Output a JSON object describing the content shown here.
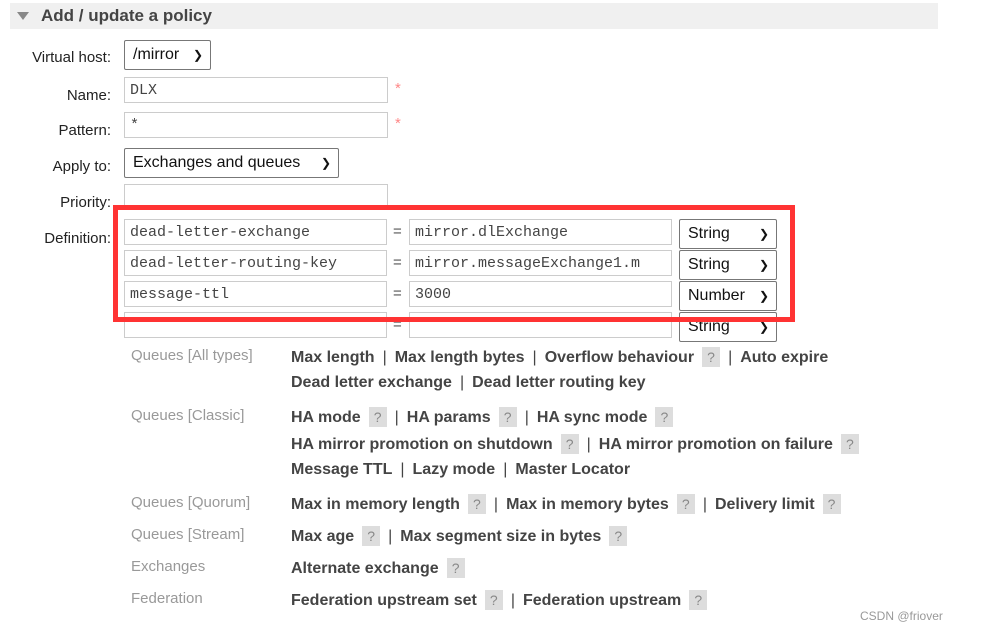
{
  "section_title": "Add / update a policy",
  "form": {
    "vhost_label": "Virtual host:",
    "vhost_value": "/mirror",
    "name_label": "Name:",
    "name_value": "DLX",
    "pattern_label": "Pattern:",
    "pattern_value": "*",
    "apply_label": "Apply to:",
    "apply_value": "Exchanges and queues",
    "priority_label": "Priority:",
    "priority_value": "",
    "definition_label": "Definition:",
    "required_mark": "*",
    "equals": "=",
    "definitions": [
      {
        "key": "dead-letter-exchange",
        "value": "mirror.dlExchange",
        "type": "String"
      },
      {
        "key": "dead-letter-routing-key",
        "value": "mirror.messageExchange1.m",
        "type": "String"
      },
      {
        "key": "message-ttl",
        "value": "3000",
        "type": "Number"
      },
      {
        "key": "",
        "value": "",
        "type": "String"
      }
    ]
  },
  "highlight_color": "#ff3333",
  "help": [
    {
      "category": "Queues [All types]",
      "lines": [
        [
          "Max length",
          "Max length bytes",
          "Overflow behaviour?",
          "Auto expire"
        ],
        [
          "Dead letter exchange",
          "Dead letter routing key"
        ]
      ]
    },
    {
      "category": "Queues [Classic]",
      "lines": [
        [
          "HA mode?",
          "HA params?",
          "HA sync mode?"
        ],
        [
          "HA mirror promotion on shutdown?",
          "HA mirror promotion on failure?"
        ],
        [
          "Message TTL",
          "Lazy mode",
          "Master Locator"
        ]
      ]
    },
    {
      "category": "Queues [Quorum]",
      "lines": [
        [
          "Max in memory length?",
          "Max in memory bytes?",
          "Delivery limit?"
        ]
      ]
    },
    {
      "category": "Queues [Stream]",
      "lines": [
        [
          "Max age?",
          "Max segment size in bytes?"
        ]
      ]
    },
    {
      "category": "Exchanges",
      "lines": [
        [
          "Alternate exchange?"
        ]
      ]
    },
    {
      "category": "Federation",
      "lines": [
        [
          "Federation upstream set?",
          "Federation upstream?"
        ]
      ]
    }
  ],
  "help_mark": "?",
  "watermark": "CSDN @friover"
}
